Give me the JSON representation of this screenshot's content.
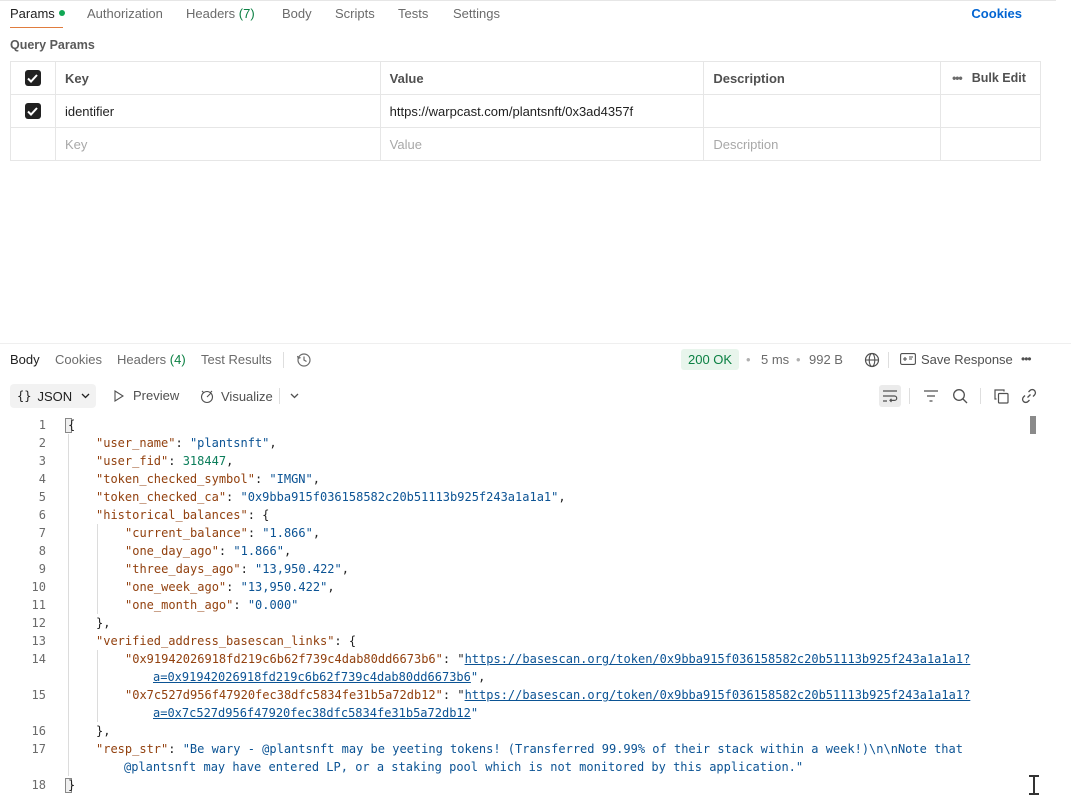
{
  "request_tabs": {
    "params": "Params",
    "authorization": "Authorization",
    "headers": "Headers",
    "headers_count": "(7)",
    "body": "Body",
    "scripts": "Scripts",
    "tests": "Tests",
    "settings": "Settings",
    "cookies": "Cookies"
  },
  "query_params": {
    "title": "Query Params",
    "columns": {
      "key": "Key",
      "value": "Value",
      "description": "Description",
      "bulk_edit": "Bulk Edit"
    },
    "rows": [
      {
        "key": "identifier",
        "value": "https://warpcast.com/plantsnft/0x3ad4357f",
        "description": ""
      }
    ],
    "placeholders": {
      "key": "Key",
      "value": "Value",
      "description": "Description"
    }
  },
  "response_tabs": {
    "body": "Body",
    "cookies": "Cookies",
    "headers": "Headers",
    "headers_count": "(4)",
    "test_results": "Test Results"
  },
  "response_meta": {
    "status": "200 OK",
    "time": "5 ms",
    "size": "992 B",
    "save_response": "Save Response"
  },
  "toolbar": {
    "format": "JSON",
    "preview": "Preview",
    "visualize": "Visualize"
  },
  "code": {
    "line_numbers": [
      "1",
      "2",
      "3",
      "4",
      "5",
      "6",
      "7",
      "8",
      "9",
      "10",
      "11",
      "12",
      "13",
      "14",
      "15",
      "16",
      "17",
      "18"
    ],
    "brace_open": "{",
    "brace_close": "}",
    "user_name_key": "\"user_name\"",
    "user_name_val": "\"plantsnft\"",
    "user_fid_key": "\"user_fid\"",
    "user_fid_val": "318447",
    "symbol_key": "\"token_checked_symbol\"",
    "symbol_val": "\"IMGN\"",
    "ca_key": "\"token_checked_ca\"",
    "ca_val": "\"0x9bba915f036158582c20b51113b925f243a1a1a1\"",
    "hist_key": "\"historical_balances\"",
    "current_key": "\"current_balance\"",
    "current_val": "\"1.866\"",
    "one_day_key": "\"one_day_ago\"",
    "one_day_val": "\"1.866\"",
    "three_days_key": "\"three_days_ago\"",
    "three_days_val": "\"13,950.422\"",
    "one_week_key": "\"one_week_ago\"",
    "one_week_val": "\"13,950.422\"",
    "one_month_key": "\"one_month_ago\"",
    "one_month_val": "\"0.000\"",
    "links_key": "\"verified_address_basescan_links\"",
    "addr1_key": "\"0x91942026918fd219c6b62f739c4dab80dd6673b6\"",
    "addr1_url_a": "https://basescan.org/token/0x9bba915f036158582c20b51113b925f243a1a1a1?",
    "addr1_url_b": "a=0x91942026918fd219c6b62f739c4dab80dd6673b6",
    "addr2_key": "\"0x7c527d956f47920fec38dfc5834fe31b5a72db12\"",
    "addr2_url_a": "https://basescan.org/token/0x9bba915f036158582c20b51113b925f243a1a1a1?",
    "addr2_url_b": "a=0x7c527d956f47920fec38dfc5834fe31b5a72db12",
    "resp_key": "\"resp_str\"",
    "resp_val_a": "\"Be wary - @plantsnft may be yeeting tokens! (Transferred 99.99% of their stack within a week!)\\n\\nNote that",
    "resp_val_b": "@plantsnft may have entered LP, or a staking pool which is not monitored by this application.\""
  },
  "colors": {
    "accent_orange": "#e07c3e",
    "link_blue": "#0265d2",
    "status_green": "#0b8043",
    "json_key": "#92410f",
    "json_string": "#0b5394",
    "json_number": "#0b7d5a"
  }
}
